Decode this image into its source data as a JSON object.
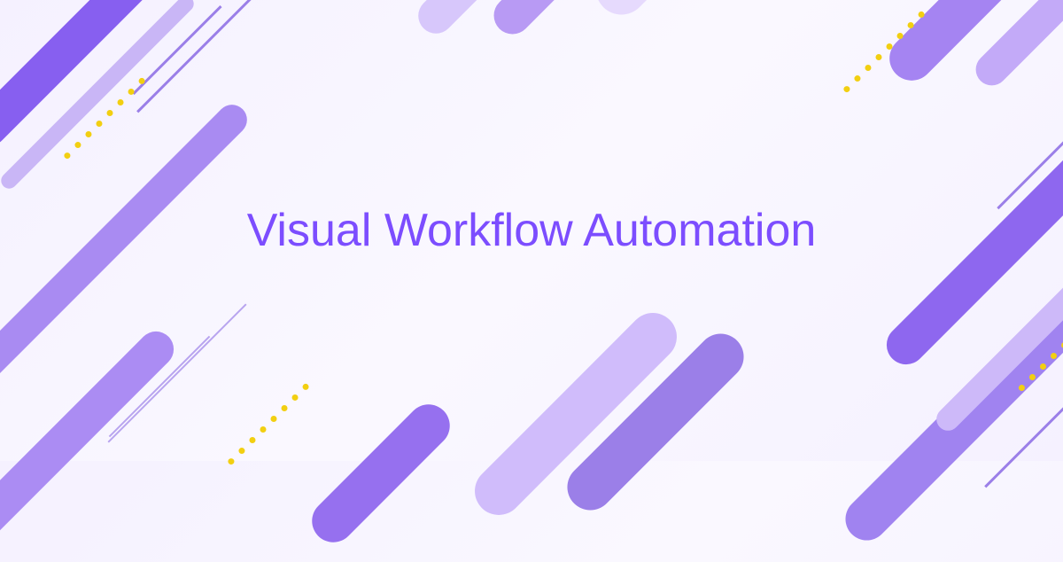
{
  "hero": {
    "title": "Visual Workflow Automation"
  },
  "palette": {
    "primary": "#7c4dff",
    "accent_dot": "#f2cf11",
    "bg_tint": "#f5f1ff"
  }
}
